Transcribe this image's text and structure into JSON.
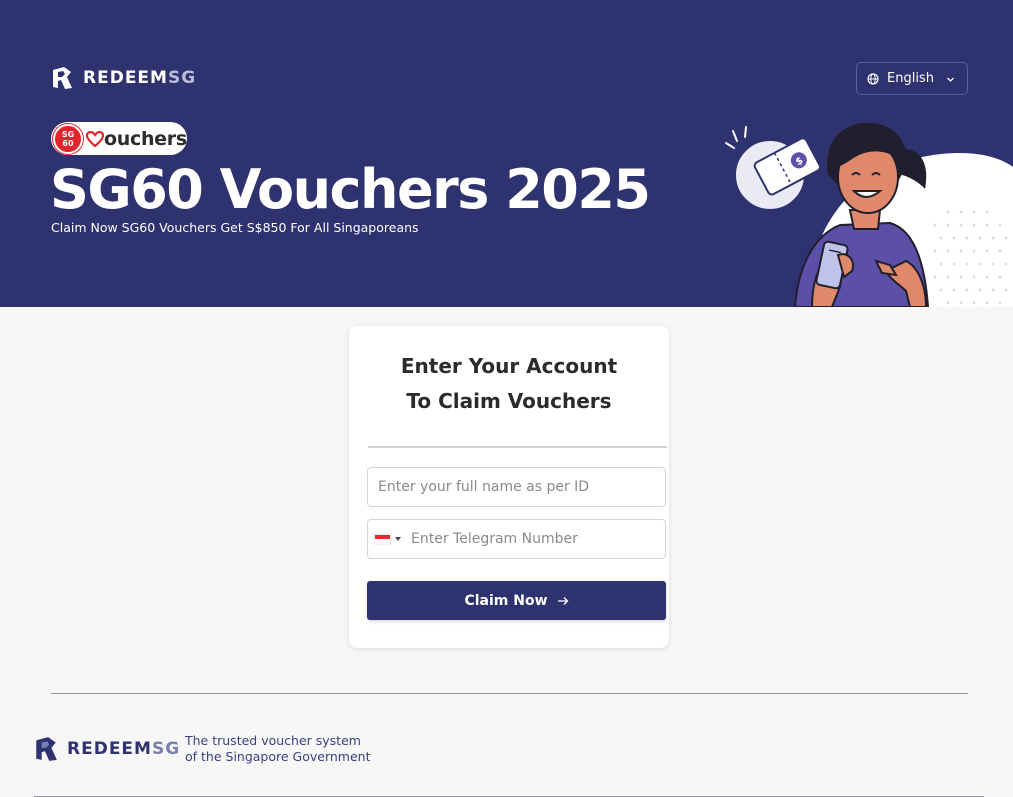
{
  "header": {
    "brand_main": "REDEEM",
    "brand_accent": "SG",
    "language": {
      "selected": "English",
      "icon": "globe-icon"
    }
  },
  "hero": {
    "badge_logo_line1": "SG",
    "badge_logo_line2": "60",
    "badge_text": "ouchers",
    "title": "SG60 Vouchers 2025",
    "subtitle": "Claim Now SG60 Vouchers Get S$850 For All Singaporeans"
  },
  "form": {
    "title_line1": "Enter Your Account",
    "title_line2": "To Claim Vouchers",
    "name_placeholder": "Enter your full name as per ID",
    "phone_placeholder": "Enter Telegram Number",
    "country_flag": "singapore-flag-icon",
    "claim_label": "Claim Now"
  },
  "footer": {
    "brand_main": "REDEEM",
    "brand_accent": "SG",
    "tagline": "The trusted voucher system of the Singapore Government"
  },
  "colors": {
    "primary": "#2e336f",
    "background": "#f7f7f8",
    "accent_red": "#e1252d",
    "accent_purple": "#5b4fa8",
    "skin": "#e0896a"
  }
}
